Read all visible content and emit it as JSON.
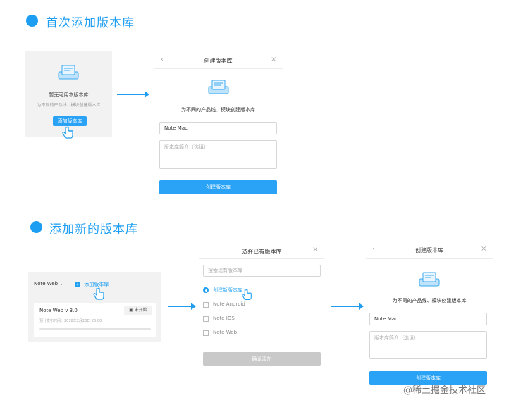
{
  "section1": {
    "title": "首次添加版本库",
    "empty_card": {
      "title": "暂无可用本版本库",
      "subtitle": "为不同的产品线、模块创建版本库",
      "button": "添加版本库"
    },
    "dialog": {
      "title": "创建版本库",
      "description": "为不同的产品线、模块创建版本库",
      "name_value": "Note Mac",
      "intro_placeholder": "版本库简介（选填）",
      "submit": "创建版本库"
    }
  },
  "section2": {
    "title": "添加新的版本库",
    "page_panel": {
      "dropdown_label": "Note Web",
      "add_link": "添加版本库",
      "version_title": "Note Web v 3.0",
      "status_badge": "未开始",
      "release_time": "预计发布时间：2018年2月28日 23:00",
      "progress": 0
    },
    "select_dialog": {
      "title": "选择已有版本库",
      "search_placeholder": "搜索现有版本库",
      "options": [
        {
          "label": "创建新版本库",
          "selected": true
        },
        {
          "label": "Note Android",
          "selected": false
        },
        {
          "label": "Note IOS",
          "selected": false
        },
        {
          "label": "Note Web",
          "selected": false
        }
      ],
      "confirm": "确认添加"
    },
    "create_dialog": {
      "title": "创建版本库",
      "description": "为不同的产品线、模块创建版本库",
      "name_value": "Note Mac",
      "intro_placeholder": "版本库简介（选填）",
      "submit": "创建版本库"
    }
  },
  "watermark": "@稀土掘金技术社区",
  "colors": {
    "accent": "#1d9ef2",
    "button": "#2aa3f7",
    "disabled": "#c9c9c9"
  }
}
